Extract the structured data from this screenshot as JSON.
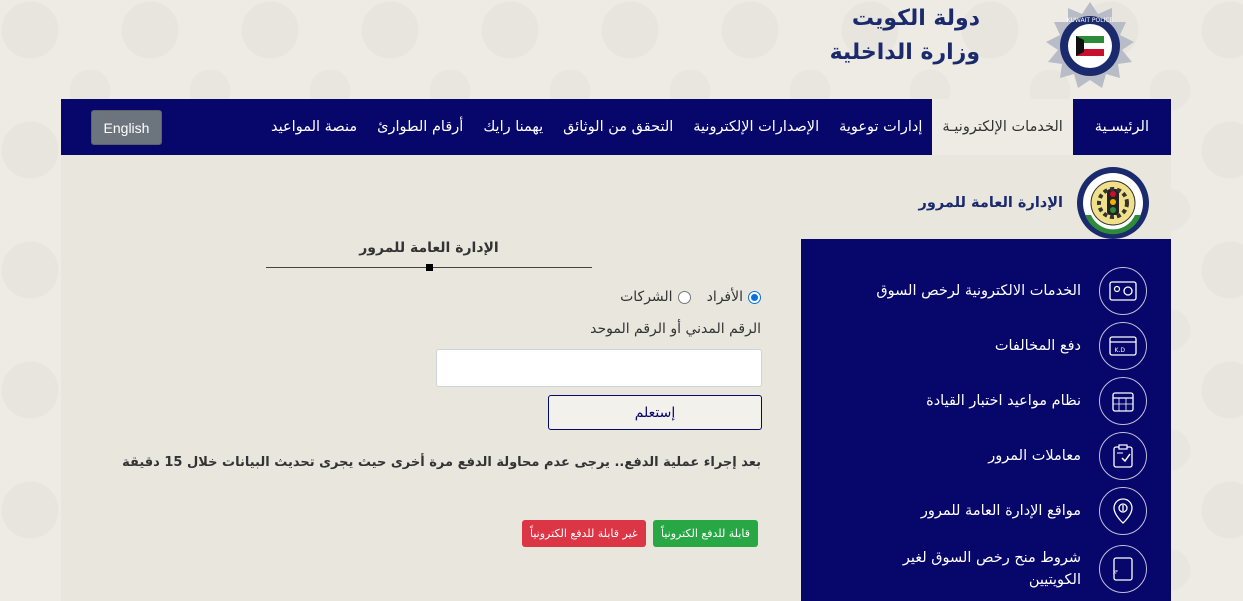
{
  "header": {
    "line1": "دولة الكويت",
    "line2": "وزارة الداخلية",
    "logo_text": "KUWAIT POLICE"
  },
  "nav": {
    "items": [
      {
        "label": "الرئيسـية",
        "active": false
      },
      {
        "label": "الخدمات الإلكترونيـة",
        "active": true
      },
      {
        "label": "إدارات توعوية",
        "active": false
      },
      {
        "label": "الإصدارات الإلكترونية",
        "active": false
      },
      {
        "label": "التحقق من الوثائق",
        "active": false
      },
      {
        "label": "يهمنا رايك",
        "active": false
      },
      {
        "label": "أرقام الطوارئ",
        "active": false
      },
      {
        "label": "منصة المواعيد",
        "active": false
      }
    ],
    "lang_button": "English"
  },
  "department": {
    "title": "الإدارة العامة للمرور"
  },
  "sidebar": {
    "items": [
      {
        "label": "الخدمات الالكترونية لرخص السوق",
        "icon": "license-card-icon"
      },
      {
        "label": "دفع المخالفات",
        "icon": "payment-card-icon"
      },
      {
        "label": "نظام مواعيد اختبار القيادة",
        "icon": "calendar-icon"
      },
      {
        "label": "معاملات المرور",
        "icon": "clipboard-check-icon"
      },
      {
        "label": "مواقع الإدارة العامة للمرور",
        "icon": "location-pin-icon"
      },
      {
        "label": "شروط منح رخص السوق لغير الكويتيين",
        "icon": "pdf-document-icon"
      }
    ]
  },
  "form": {
    "title": "الإدارة العامة للمرور",
    "radio_individuals": "الأفراد",
    "radio_companies": "الشركات",
    "selected": "individuals",
    "field_label": "الرقم المدني أو الرقم الموحد",
    "input_value": "",
    "query_button": "إستعلم",
    "note": "بعد إجراء عملية الدفع.. يرجى عدم محاولة الدفع مرة أخرى حيث يجرى تحديث البيانات خلال 15 دقيقة",
    "badge_payable": "قابلة للدفع الكترونياً",
    "badge_not_payable": "غير قابلة للدفع الكترونياً"
  },
  "colors": {
    "navy": "#06066b",
    "green": "#28a745",
    "red": "#dc3545"
  }
}
